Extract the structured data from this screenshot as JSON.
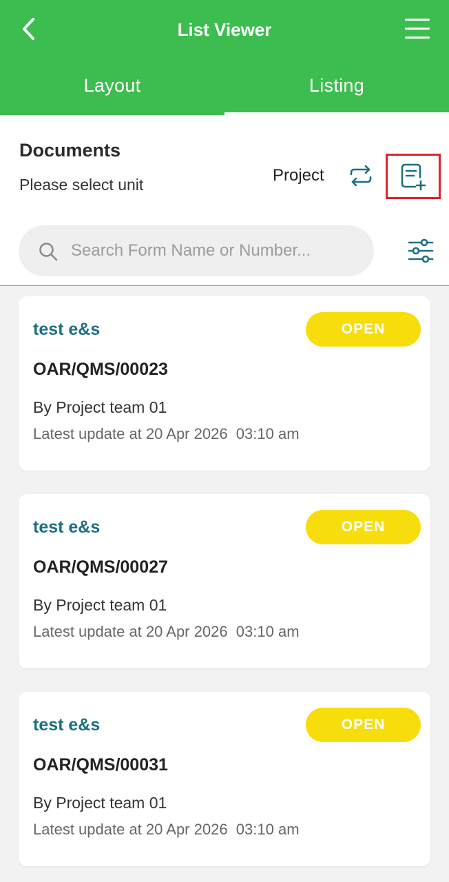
{
  "header": {
    "title": "List Viewer",
    "back_icon": "chevron-left-icon",
    "menu_icon": "hamburger-menu-icon",
    "color": "#3dbd4f"
  },
  "tabs": [
    {
      "label": "Layout",
      "active": true
    },
    {
      "label": "Listing",
      "active": false
    }
  ],
  "section": {
    "title": "Documents",
    "subtitle": "Please select unit",
    "project_label": "Project",
    "swap_icon": "swap-icon",
    "add_icon": "add-document-icon",
    "highlight_color": "#e0212a"
  },
  "search": {
    "placeholder": "Search Form Name or Number...",
    "value": "",
    "icon": "search-icon",
    "filter_icon": "filter-sliders-icon"
  },
  "documents": [
    {
      "name": "test e&s",
      "status": "OPEN",
      "number": "OAR/QMS/00023",
      "author": "By Project team 01",
      "updated": "Latest update at 20 Apr 2026  03:10 am"
    },
    {
      "name": "test e&s",
      "status": "OPEN",
      "number": "OAR/QMS/00027",
      "author": "By Project team 01",
      "updated": "Latest update at 20 Apr 2026  03:10 am"
    },
    {
      "name": "test e&s",
      "status": "OPEN",
      "number": "OAR/QMS/00031",
      "author": "By Project team 01",
      "updated": "Latest update at 20 Apr 2026  03:10 am"
    }
  ],
  "colors": {
    "status_badge": "#f7dd0c",
    "doc_name": "#1b6f80",
    "icon_teal": "#1b6f80"
  }
}
